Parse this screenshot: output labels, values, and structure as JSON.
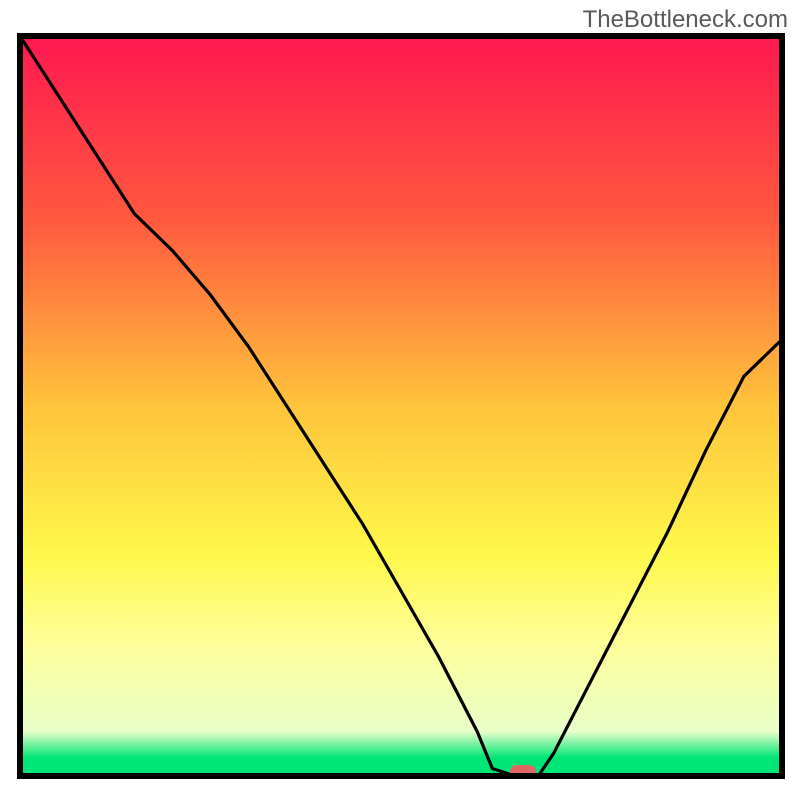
{
  "watermark": "TheBottleneck.com",
  "chart_data": {
    "type": "line",
    "title": "",
    "xlabel": "",
    "ylabel": "",
    "xlim": [
      0,
      100
    ],
    "ylim": [
      0,
      100
    ],
    "axes_visible": false,
    "gradient_background": true,
    "gradient_stops": [
      {
        "pos": 0.0,
        "color": "#ff1850"
      },
      {
        "pos": 0.25,
        "color": "#ff5a3f"
      },
      {
        "pos": 0.5,
        "color": "#ffc43c"
      },
      {
        "pos": 0.7,
        "color": "#fff84a"
      },
      {
        "pos": 0.82,
        "color": "#ffff9a"
      },
      {
        "pos": 0.94,
        "color": "#e8ffc8"
      },
      {
        "pos": 0.975,
        "color": "#00e676"
      }
    ],
    "series": [
      {
        "name": "bottleneck-curve",
        "x": [
          0,
          5,
          10,
          15,
          20,
          25,
          30,
          35,
          40,
          45,
          50,
          55,
          60,
          62,
          65,
          68,
          70,
          75,
          80,
          85,
          90,
          95,
          100
        ],
        "values": [
          100,
          92,
          84,
          76,
          71,
          65,
          58,
          50,
          42,
          34,
          25,
          16,
          6,
          1,
          0,
          0,
          3,
          13,
          23,
          33,
          44,
          54,
          59
        ]
      }
    ],
    "marker": {
      "x": 66,
      "y": 0,
      "color": "#e06666",
      "shape": "rounded-pill"
    },
    "plot_frame_color": "#000000",
    "background_outside_plot": "#ffffff"
  }
}
